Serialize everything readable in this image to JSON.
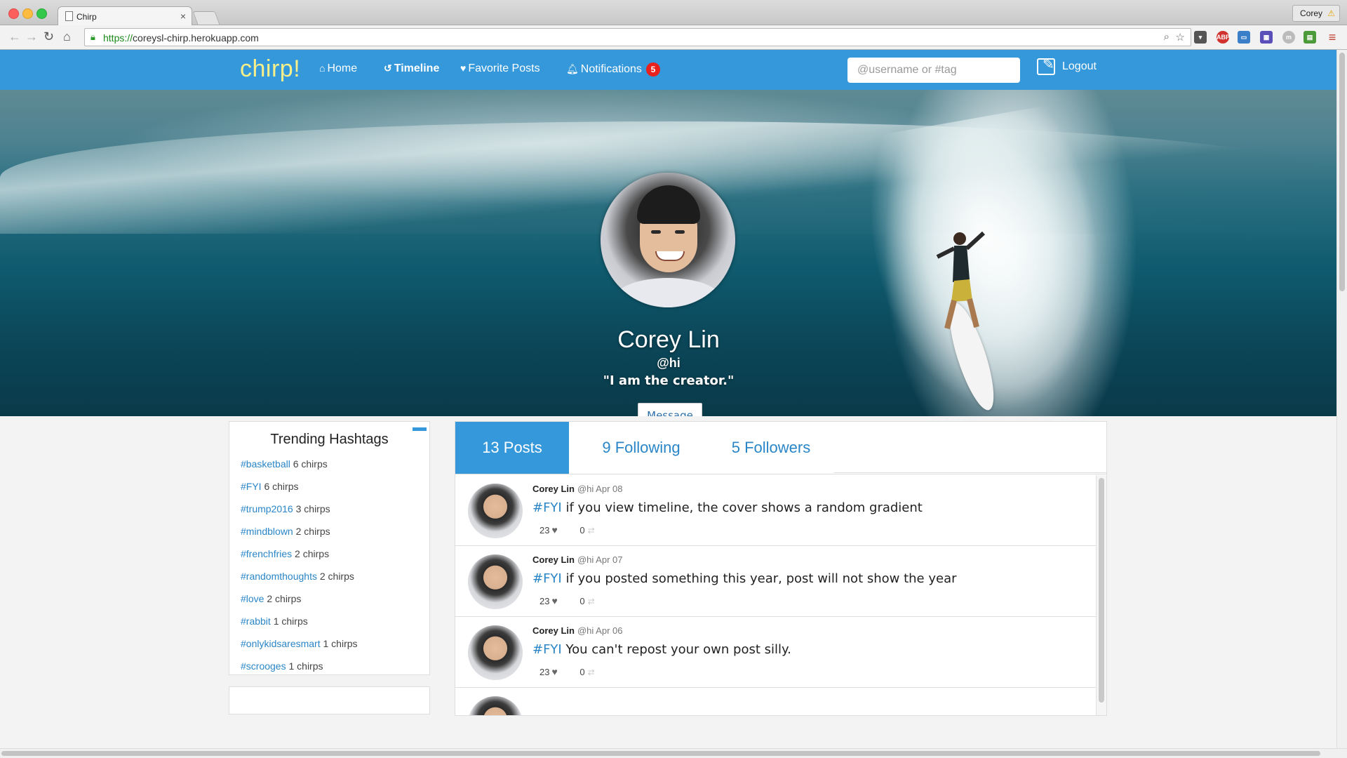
{
  "browser": {
    "tab_title": "Chirp",
    "tab_close": "×",
    "profile_name": "Corey",
    "url_scheme": "https://",
    "url_rest": "coreysl-chirp.herokuapp.com"
  },
  "nav": {
    "brand": "chirp!",
    "home": "Home",
    "timeline": "Timeline",
    "favorites": "Favorite Posts",
    "notifications": "Notifications",
    "notif_count": "5",
    "search_placeholder": "@username or #tag",
    "logout": "Logout"
  },
  "profile": {
    "name": "Corey Lin",
    "handle": "@hi",
    "bio": "\"I am the creator.\"",
    "message_label": "Message"
  },
  "trending": {
    "title": "Trending Hashtags",
    "items": [
      {
        "tag": "#basketball",
        "count": "6 chirps"
      },
      {
        "tag": "#FYI",
        "count": "6 chirps"
      },
      {
        "tag": "#trump2016",
        "count": "3 chirps"
      },
      {
        "tag": "#mindblown",
        "count": "2 chirps"
      },
      {
        "tag": "#frenchfries",
        "count": "2 chirps"
      },
      {
        "tag": "#randomthoughts",
        "count": "2 chirps"
      },
      {
        "tag": "#love",
        "count": "2 chirps"
      },
      {
        "tag": "#rabbit",
        "count": "1 chirps"
      },
      {
        "tag": "#onlykidsaresmart",
        "count": "1 chirps"
      },
      {
        "tag": "#scrooges",
        "count": "1 chirps"
      }
    ]
  },
  "tabs": {
    "posts": "13 Posts",
    "following": "9 Following",
    "followers": "5 Followers"
  },
  "posts": [
    {
      "author": "Corey Lin",
      "meta": "@hi Apr 08",
      "hashtag": "#FYI",
      "text": " if you view timeline, the cover shows a random gradient",
      "likes": "23",
      "reposts": "0"
    },
    {
      "author": "Corey Lin",
      "meta": "@hi Apr 07",
      "hashtag": "#FYI",
      "text": " if you posted something this year, post will not show the year",
      "likes": "23",
      "reposts": "0"
    },
    {
      "author": "Corey Lin",
      "meta": "@hi Apr 06",
      "hashtag": "#FYI",
      "text": " You can't repost your own post silly.",
      "likes": "23",
      "reposts": "0"
    }
  ],
  "colors": {
    "nav_blue": "#3498db",
    "brand_yellow": "#f7f08a",
    "link_blue": "#2a86c7",
    "badge_red": "#e8201e"
  }
}
